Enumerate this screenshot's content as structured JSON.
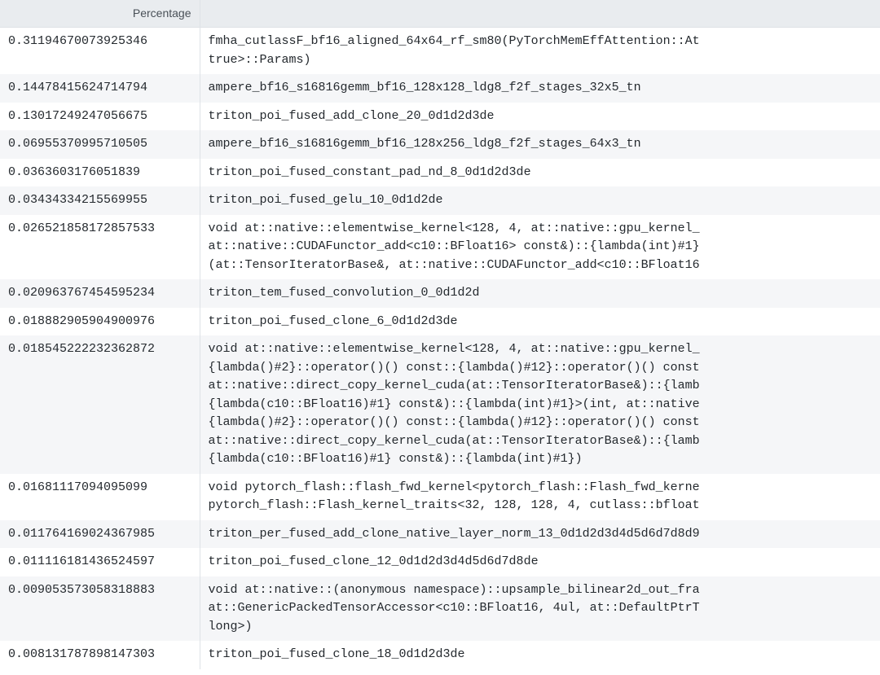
{
  "columns": {
    "percentage": "Percentage",
    "kernel": ""
  },
  "rows": [
    {
      "percentage": "0.31194670073925346",
      "kernel": "fmha_cutlassF_bf16_aligned_64x64_rf_sm80(PyTorchMemEffAttention::At\ntrue>::Params)"
    },
    {
      "percentage": "0.14478415624714794",
      "kernel": "ampere_bf16_s16816gemm_bf16_128x128_ldg8_f2f_stages_32x5_tn"
    },
    {
      "percentage": "0.13017249247056675",
      "kernel": "triton_poi_fused_add_clone_20_0d1d2d3de"
    },
    {
      "percentage": "0.06955370995710505",
      "kernel": "ampere_bf16_s16816gemm_bf16_128x256_ldg8_f2f_stages_64x3_tn"
    },
    {
      "percentage": "0.0363603176051839",
      "kernel": "triton_poi_fused_constant_pad_nd_8_0d1d2d3de"
    },
    {
      "percentage": "0.03434334215569955",
      "kernel": "triton_poi_fused_gelu_10_0d1d2de"
    },
    {
      "percentage": "0.026521858172857533",
      "kernel": "void at::native::elementwise_kernel<128, 4, at::native::gpu_kernel_\nat::native::CUDAFunctor_add<c10::BFloat16> const&)::{lambda(int)#1}\n(at::TensorIteratorBase&, at::native::CUDAFunctor_add<c10::BFloat16"
    },
    {
      "percentage": "0.020963767454595234",
      "kernel": "triton_tem_fused_convolution_0_0d1d2d"
    },
    {
      "percentage": "0.018882905904900976",
      "kernel": "triton_poi_fused_clone_6_0d1d2d3de"
    },
    {
      "percentage": "0.018545222232362872",
      "kernel": "void at::native::elementwise_kernel<128, 4, at::native::gpu_kernel_\n{lambda()#2}::operator()() const::{lambda()#12}::operator()() const\nat::native::direct_copy_kernel_cuda(at::TensorIteratorBase&)::{lamb\n{lambda(c10::BFloat16)#1} const&)::{lambda(int)#1}>(int, at::native\n{lambda()#2}::operator()() const::{lambda()#12}::operator()() const\nat::native::direct_copy_kernel_cuda(at::TensorIteratorBase&)::{lamb\n{lambda(c10::BFloat16)#1} const&)::{lambda(int)#1})"
    },
    {
      "percentage": "0.01681117094095099",
      "kernel": "void pytorch_flash::flash_fwd_kernel<pytorch_flash::Flash_fwd_kerne\npytorch_flash::Flash_kernel_traits<32, 128, 128, 4, cutlass::bfloat"
    },
    {
      "percentage": "0.011764169024367985",
      "kernel": "triton_per_fused_add_clone_native_layer_norm_13_0d1d2d3d4d5d6d7d8d9"
    },
    {
      "percentage": "0.011116181436524597",
      "kernel": "triton_poi_fused_clone_12_0d1d2d3d4d5d6d7d8de"
    },
    {
      "percentage": "0.009053573058318883",
      "kernel": "void at::native::(anonymous namespace)::upsample_bilinear2d_out_fra\nat::GenericPackedTensorAccessor<c10::BFloat16, 4ul, at::DefaultPtrT\nlong>)"
    },
    {
      "percentage": "0.008131787898147303",
      "kernel": "triton_poi_fused_clone_18_0d1d2d3de"
    }
  ]
}
